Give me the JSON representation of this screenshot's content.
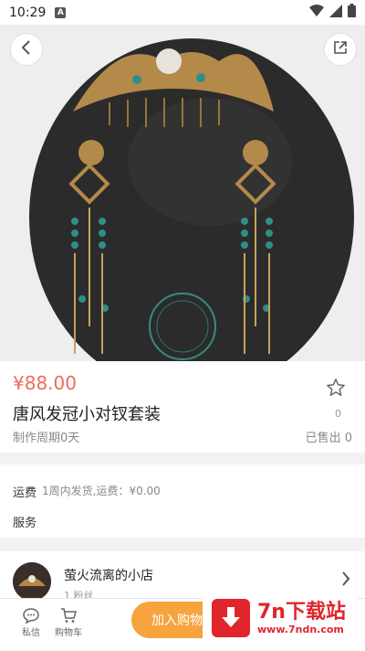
{
  "status_bar": {
    "time": "10:29",
    "notif_badge": "A",
    "wifi_icon": "wifi-icon",
    "signal_icon": "signal-icon",
    "battery_icon": "battery-icon"
  },
  "product": {
    "price": "¥88.00",
    "title": "唐风发冠小对钗套装",
    "period": "制作周期0天",
    "fav_count": "0",
    "sold": "已售出 0"
  },
  "shipping": {
    "label": "运费",
    "value": "1周内发货,运费：¥0.00",
    "service_label": "服务"
  },
  "shop": {
    "name": "萤火流离的小店",
    "sub": "1 粉丝"
  },
  "bottom_bar": {
    "chat_label": "私信",
    "cart_label": "购物车",
    "add_cart_label": "加入购物"
  },
  "watermark": {
    "title": "7n下载站",
    "url": "www.7ndn.com"
  },
  "colors": {
    "price": "#f06b5a",
    "accent": "#f7a43f",
    "brand": "#e0252b"
  }
}
